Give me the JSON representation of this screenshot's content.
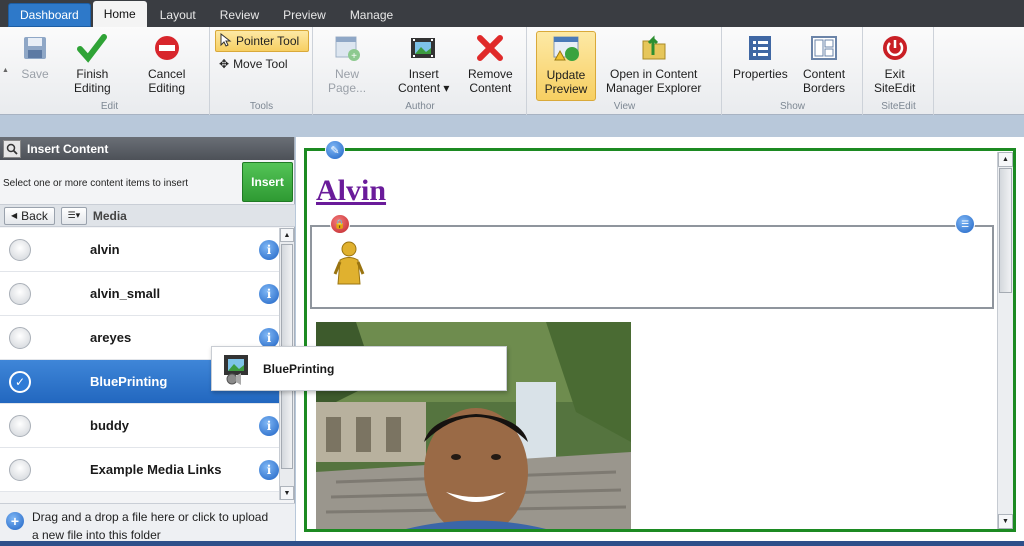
{
  "tabs": [
    "Dashboard",
    "Home",
    "Layout",
    "Review",
    "Preview",
    "Manage"
  ],
  "ribbon": {
    "edit": {
      "label": "Edit",
      "save": "Save",
      "finish": [
        "Finish",
        "Editing"
      ],
      "cancel": [
        "Cancel",
        "Editing"
      ]
    },
    "tools": {
      "label": "Tools",
      "pointer": "Pointer Tool",
      "move": "Move Tool"
    },
    "author": {
      "label": "Author",
      "new_page": [
        "New",
        "Page..."
      ],
      "insert_content": [
        "Insert",
        "Content ▾"
      ],
      "remove_content": [
        "Remove",
        "Content"
      ]
    },
    "view": {
      "label": "View",
      "update_preview": [
        "Update",
        "Preview"
      ],
      "open_cme": [
        "Open in Content",
        "Manager Explorer"
      ]
    },
    "show": {
      "label": "Show",
      "properties": "Properties",
      "content_borders": [
        "Content",
        "Borders"
      ]
    },
    "siteedit": {
      "label": "SiteEdit",
      "exit": [
        "Exit",
        "SiteEdit"
      ]
    }
  },
  "panel": {
    "title": "Insert Content",
    "instruction": "Select one or more content items to insert",
    "insert_label": "Insert",
    "back_label": "Back",
    "breadcrumb": "Media",
    "items": [
      {
        "name": "alvin",
        "selected": false
      },
      {
        "name": "alvin_small",
        "selected": false
      },
      {
        "name": "areyes",
        "selected": false
      },
      {
        "name": "BluePrinting",
        "selected": true
      },
      {
        "name": "buddy",
        "selected": false
      },
      {
        "name": "Example Media Links",
        "selected": false
      }
    ],
    "upload_text": [
      "Drag and a drop a file here or click to upload",
      "a new file into this folder"
    ]
  },
  "drag_preview": {
    "name": "BluePrinting"
  },
  "page": {
    "title": "Alvin"
  }
}
